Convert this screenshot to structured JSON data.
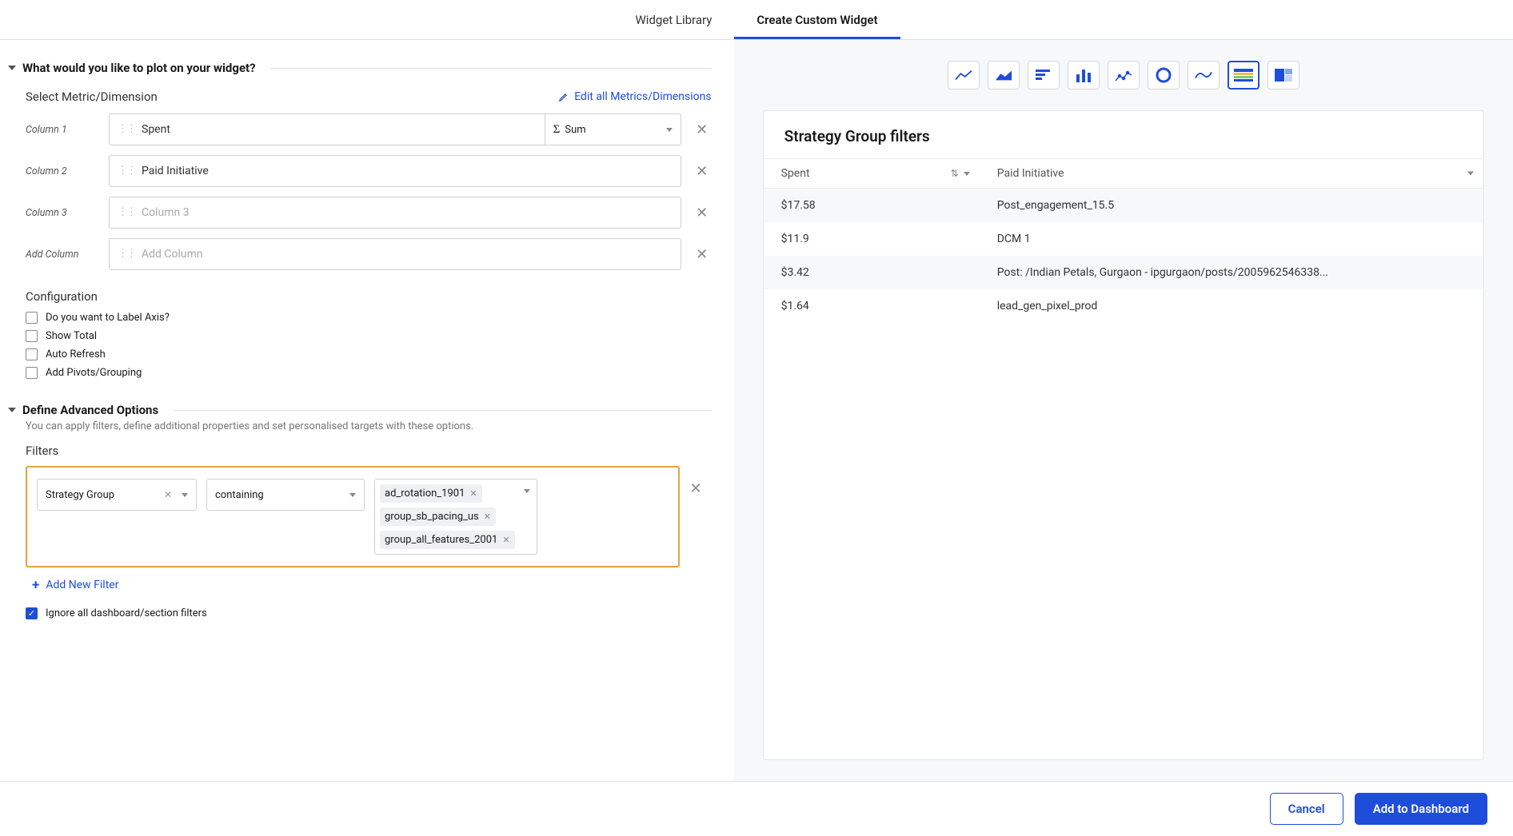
{
  "tabs": {
    "library": "Widget Library",
    "create": "Create Custom Widget"
  },
  "sections": {
    "plot_title": "What would you like to plot on your widget?",
    "select_metric": "Select Metric/Dimension",
    "edit_all": "Edit all Metrics/Dimensions",
    "col1_label": "Column 1",
    "col1_value": "Spent",
    "col1_agg": "Sum",
    "col2_label": "Column 2",
    "col2_value": "Paid Initiative",
    "col3_label": "Column 3",
    "col3_placeholder": "Column 3",
    "addcol_label": "Add Column",
    "addcol_placeholder": "Add Column",
    "config_title": "Configuration",
    "cfg1": "Do you want to Label Axis?",
    "cfg2": "Show Total",
    "cfg3": "Auto Refresh",
    "cfg4": "Add Pivots/Grouping",
    "adv_title": "Define Advanced Options",
    "adv_sub": "You can apply filters, define additional properties and set personalised targets with these options.",
    "filters_title": "Filters",
    "filter_field": "Strategy Group",
    "filter_op": "containing",
    "tag1": "ad_rotation_1901",
    "tag2": "group_sb_pacing_us",
    "tag3": "group_all_features_2001",
    "add_filter": "Add New Filter",
    "ignore_filters": "Ignore all dashboard/section filters"
  },
  "preview": {
    "title": "Strategy Group filters",
    "h1": "Spent",
    "h2": "Paid Initiative",
    "rows": [
      {
        "a": "$17.58",
        "b": "Post_engagement_15.5"
      },
      {
        "a": "$11.9",
        "b": "DCM 1"
      },
      {
        "a": "$3.42",
        "b": "Post: /Indian Petals, Gurgaon - ipgurgaon/posts/2005962546338..."
      },
      {
        "a": "$1.64",
        "b": "lead_gen_pixel_prod"
      }
    ]
  },
  "footer": {
    "cancel": "Cancel",
    "add": "Add to Dashboard"
  },
  "chart_data": {
    "type": "table",
    "title": "Strategy Group filters",
    "columns": [
      "Spent",
      "Paid Initiative"
    ],
    "rows": [
      [
        "$17.58",
        "Post_engagement_15.5"
      ],
      [
        "$11.9",
        "DCM 1"
      ],
      [
        "$3.42",
        "Post: /Indian Petals, Gurgaon - ipgurgaon/posts/2005962546338..."
      ],
      [
        "$1.64",
        "lead_gen_pixel_prod"
      ]
    ]
  }
}
